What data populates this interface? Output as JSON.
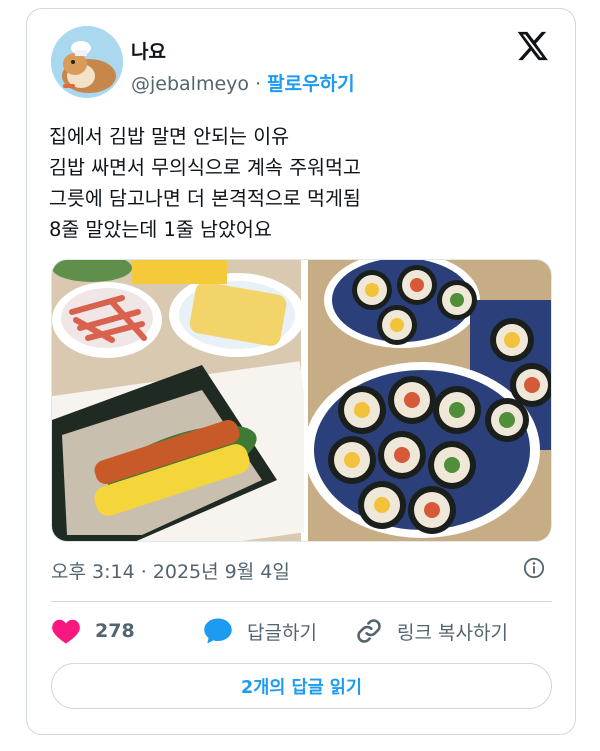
{
  "author": {
    "display_name": "나요",
    "handle": "@jebalmeyo",
    "separator": "·",
    "follow_label": "팔로우하기"
  },
  "tweet": {
    "lines": [
      "집에서 김밥 말면 안되는 이유",
      "김밥 싸면서 무의식으로 계속 주워먹고",
      "그릇에 담고나면 더 본격적으로 먹게됨",
      "8줄 말았는데 1줄 남았어요"
    ],
    "timestamp": "오후 3:14 · 2025년 9월 4일"
  },
  "actions": {
    "like_count": "278",
    "reply_label": "답글하기",
    "copy_link_label": "링크 복사하기"
  },
  "replies_button_label": "2개의 답글 읽기",
  "colors": {
    "accent": "#1d9bf0",
    "like": "#f91880",
    "text": "#0f1419",
    "muted": "#536471",
    "border": "#cfd9de"
  },
  "icons": [
    "x-logo-icon",
    "info-icon",
    "heart-icon",
    "reply-bubble-icon",
    "link-icon"
  ]
}
